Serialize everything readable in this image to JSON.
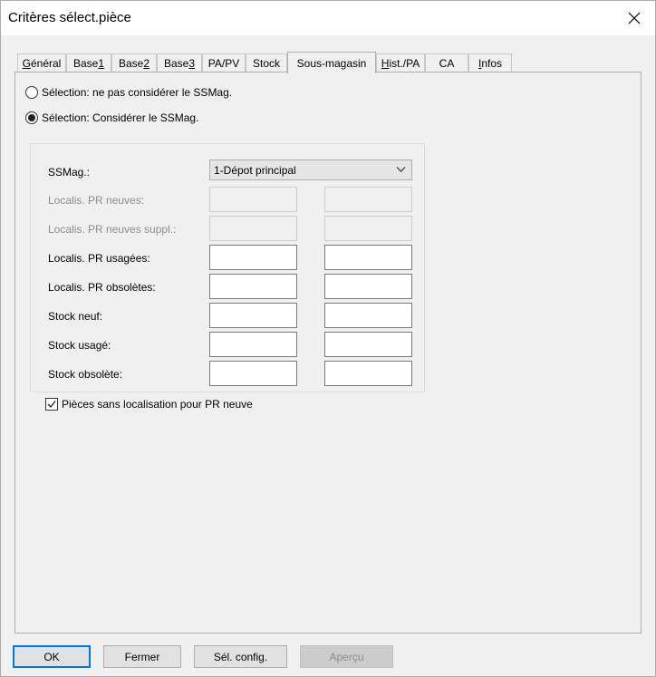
{
  "window": {
    "title": "Critères sélect.pièce"
  },
  "tabs": [
    {
      "pre": "",
      "u": "G",
      "post": "énéral"
    },
    {
      "pre": "Base ",
      "u": "1",
      "post": ""
    },
    {
      "pre": "Base ",
      "u": "2",
      "post": ""
    },
    {
      "pre": "Base ",
      "u": "3",
      "post": ""
    },
    {
      "pre": "PA/PV",
      "u": "",
      "post": ""
    },
    {
      "pre": "Stock",
      "u": "",
      "post": ""
    },
    {
      "pre": "Sous-magasin",
      "u": "",
      "post": ""
    },
    {
      "pre": "",
      "u": "H",
      "post": "ist./PA"
    },
    {
      "pre": "CA",
      "u": "",
      "post": ""
    },
    {
      "pre": "",
      "u": "I",
      "post": "nfos"
    }
  ],
  "selection": {
    "option_ignore": "Sélection: ne pas considérer le SSMag.",
    "option_consider": "Sélection: Considérer le SSMag."
  },
  "form": {
    "ssmag_label": "SSMag.:",
    "ssmag_value": "1-Dépot principal",
    "loc_new_label": "Localis. PR neuves:",
    "loc_new_suppl_label": "Localis. PR neuves suppl.:",
    "loc_used_label": "Localis. PR usagées:",
    "loc_obsolete_label": "Localis. PR obsolètes:",
    "stock_new_label": "Stock neuf:",
    "stock_used_label": "Stock usagé:",
    "stock_obsolete_label": "Stock obsolète:"
  },
  "checkbox": {
    "label": "Pièces sans localisation pour PR neuve",
    "checked": true
  },
  "buttons": {
    "ok": "OK",
    "close": "Fermer",
    "select_config": "Sél. config.",
    "preview": "Aperçu"
  }
}
